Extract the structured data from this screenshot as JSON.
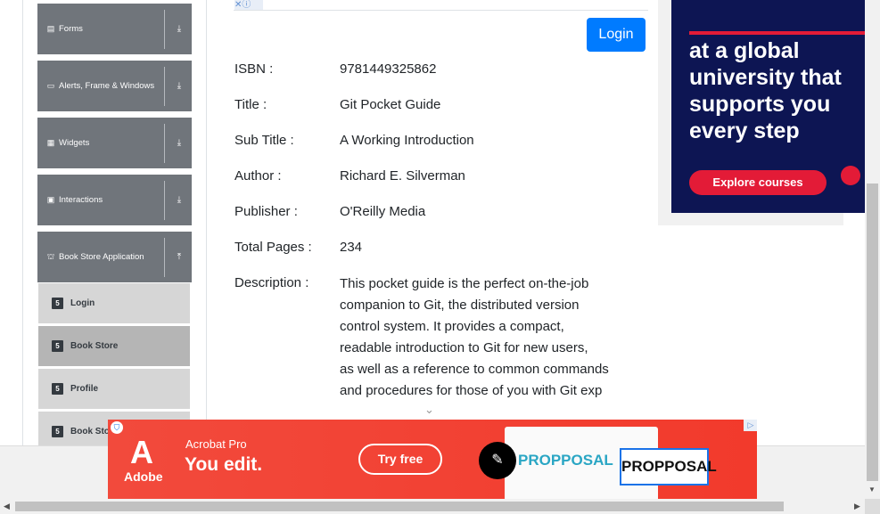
{
  "sidebar": {
    "groups": [
      {
        "label": "Forms",
        "icon": "form-icon",
        "arrow": "download-arrow-icon"
      },
      {
        "label": "Alerts, Frame & Windows",
        "icon": "window-icon",
        "arrow": "download-arrow-icon"
      },
      {
        "label": "Widgets",
        "icon": "grid-icon",
        "arrow": "download-arrow-icon"
      },
      {
        "label": "Interactions",
        "icon": "interaction-icon",
        "arrow": "download-arrow-icon"
      },
      {
        "label": "Book Store Application",
        "icon": "book-store-icon",
        "arrow": "upload-arrow-icon"
      }
    ],
    "items": [
      {
        "label": "Login",
        "active": false
      },
      {
        "label": "Book Store",
        "active": true
      },
      {
        "label": "Profile",
        "active": false
      },
      {
        "label": "Book Store API",
        "active": false
      }
    ]
  },
  "header": {
    "login_label": "Login"
  },
  "book": {
    "isbn_label": "ISBN :",
    "isbn": "9781449325862",
    "title_label": "Title :",
    "title": "Git Pocket Guide",
    "subtitle_label": "Sub Title :",
    "subtitle": "A Working Introduction",
    "author_label": "Author :",
    "author": "Richard E. Silverman",
    "publisher_label": "Publisher :",
    "publisher": "O'Reilly Media",
    "pages_label": "Total Pages :",
    "pages": "234",
    "description_label": "Description :",
    "description_lines": [
      "This pocket guide is the perfect on-the-job",
      "companion to Git, the distributed version",
      "control system. It provides a compact,",
      "readable introduction to Git for new users,",
      "as well as a reference to common commands",
      "and procedures for those of you with Git exp"
    ]
  },
  "ad_right": {
    "headline": "at a global university that supports you every step",
    "cta": "Explore courses",
    "brand_color": "#0d1553",
    "accent_color": "#e31b37"
  },
  "ad_bottom": {
    "brand": "Adobe",
    "product": "Acrobat Pro",
    "tagline": "You edit.",
    "cta": "Try free",
    "doc_text_1": "PROPPOSAL",
    "doc_text_2": "PROPPOSAL",
    "bg_color": "#f24a3c"
  },
  "colors": {
    "primary": "#007bff",
    "sidebar_group": "#70757b",
    "sidebar_item": "#d6d6d6"
  }
}
